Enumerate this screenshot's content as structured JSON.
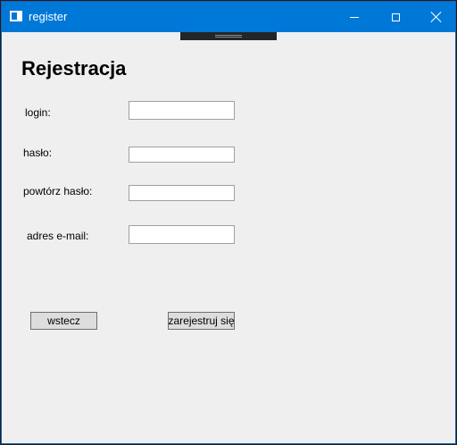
{
  "window": {
    "title": "register"
  },
  "form": {
    "heading": "Rejestracja",
    "fields": [
      {
        "label": "login:",
        "value": ""
      },
      {
        "label": "hasło:",
        "value": ""
      },
      {
        "label": "powtórz hasło:",
        "value": ""
      },
      {
        "label": "adres e-mail:",
        "value": ""
      }
    ],
    "buttons": {
      "back": "wstecz",
      "register": "zarejestruj się"
    }
  },
  "icons": {
    "app": "window-app-icon",
    "minimize": "minimize-icon",
    "maximize": "maximize-icon",
    "close": "close-icon"
  },
  "colors": {
    "titlebar": "#0078d7",
    "background": "#efefef"
  }
}
